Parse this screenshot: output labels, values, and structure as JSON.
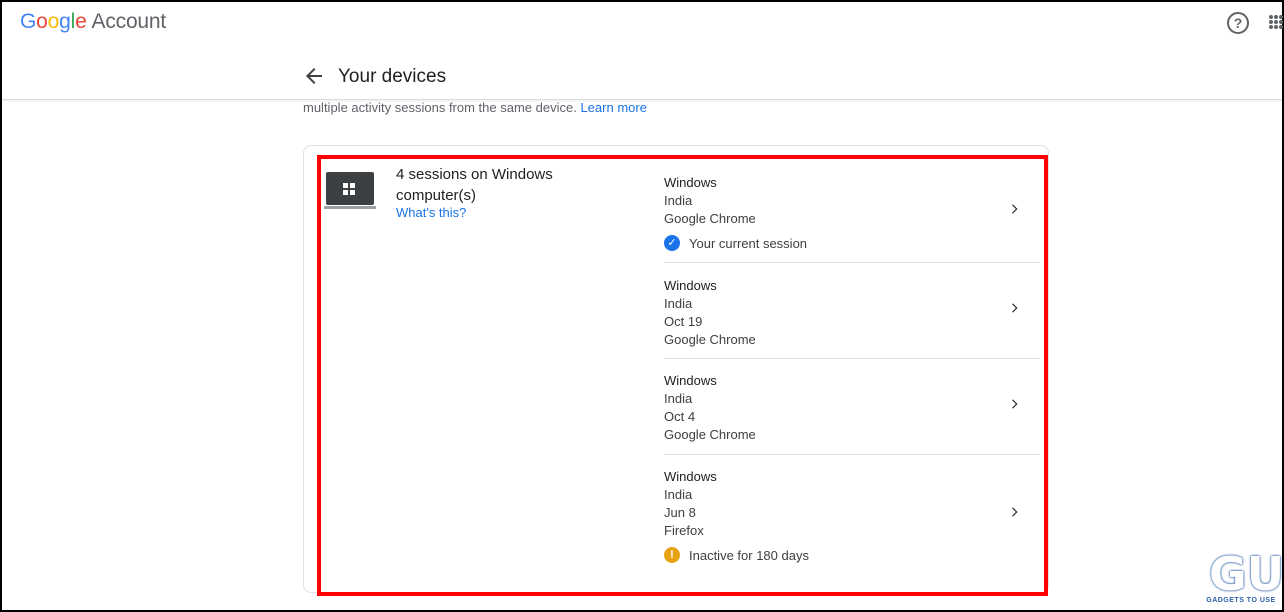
{
  "header": {
    "logo_google": [
      "G",
      "o",
      "o",
      "g",
      "l",
      "e"
    ],
    "logo_account": "Account",
    "help_icon": "help-circle-icon",
    "apps_icon": "apps-grid-icon"
  },
  "page": {
    "title": "Your devices",
    "back_icon": "back-arrow-icon",
    "intro_text": "multiple activity sessions from the same device.",
    "learn_more": "Learn more"
  },
  "device_group": {
    "icon": "windows-laptop-icon",
    "title": "4 sessions on Windows computer(s)",
    "whats_this": "What's this?",
    "sessions": [
      {
        "os": "Windows",
        "location": "India",
        "date": "",
        "browser": "Google Chrome",
        "status": "Your current session",
        "status_icon": "check-circle-icon"
      },
      {
        "os": "Windows",
        "location": "India",
        "date": "Oct 19",
        "browser": "Google Chrome",
        "status": "",
        "status_icon": ""
      },
      {
        "os": "Windows",
        "location": "India",
        "date": "Oct 4",
        "browser": "Google Chrome",
        "status": "",
        "status_icon": ""
      },
      {
        "os": "Windows",
        "location": "India",
        "date": "Jun 8",
        "browser": "Firefox",
        "status": "Inactive for 180 days",
        "status_icon": "warning-circle-icon"
      }
    ]
  },
  "watermark": {
    "mark": "GU",
    "text": "GADGETS TO USE"
  },
  "colors": {
    "accent": "#1a73e8",
    "highlight": "#ff0000",
    "warning": "#e8a314"
  }
}
